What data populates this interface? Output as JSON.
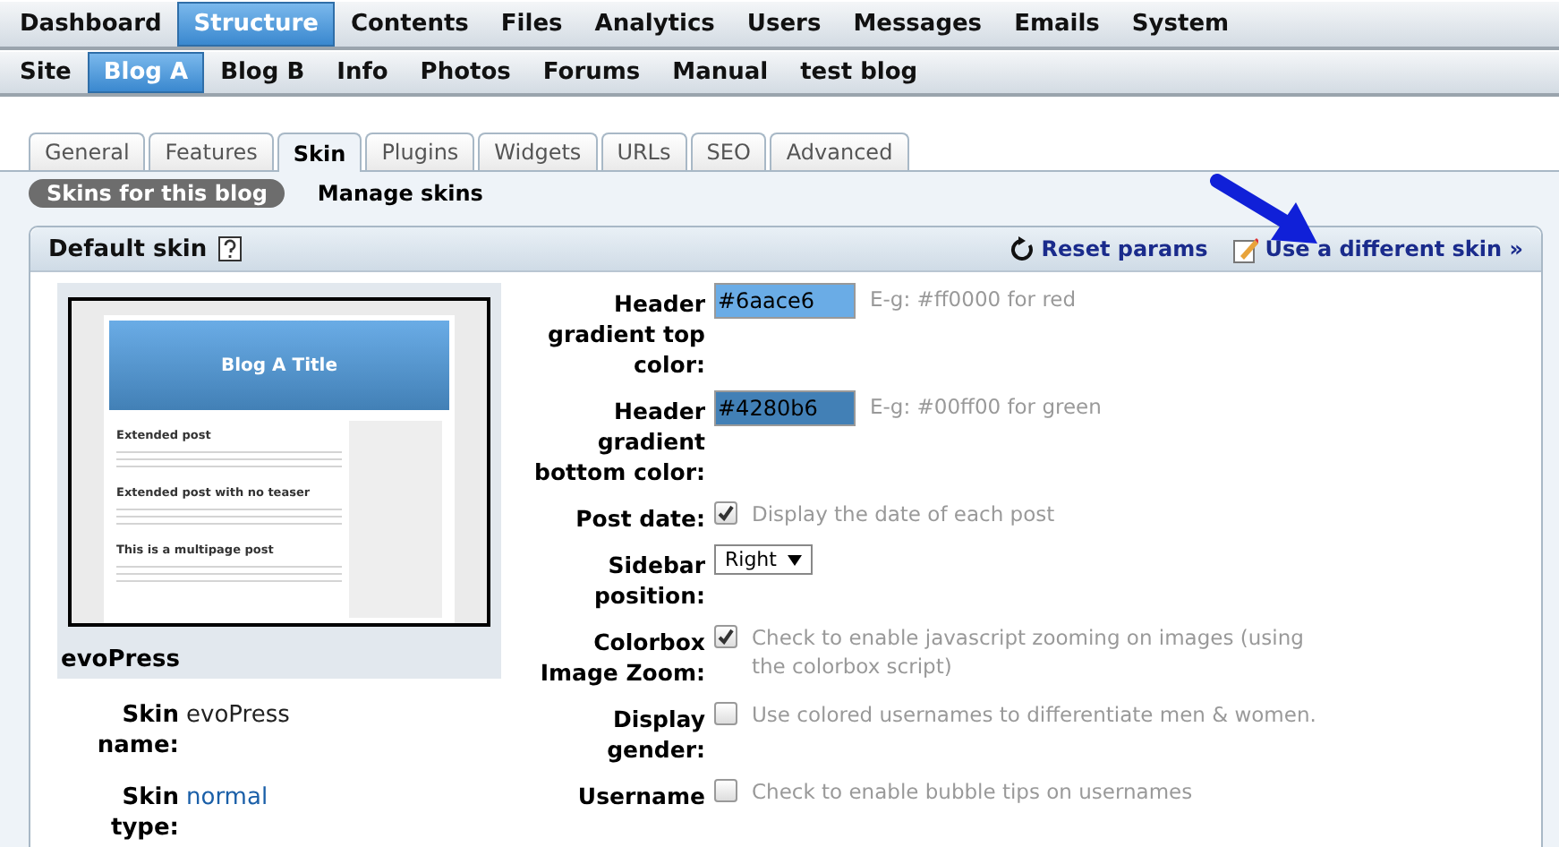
{
  "main_menu": [
    {
      "label": "Dashboard",
      "selected": false
    },
    {
      "label": "Structure",
      "selected": true
    },
    {
      "label": "Contents",
      "selected": false
    },
    {
      "label": "Files",
      "selected": false
    },
    {
      "label": "Analytics",
      "selected": false
    },
    {
      "label": "Users",
      "selected": false
    },
    {
      "label": "Messages",
      "selected": false
    },
    {
      "label": "Emails",
      "selected": false
    },
    {
      "label": "System",
      "selected": false
    }
  ],
  "blog_menu": [
    {
      "label": "Site",
      "selected": false
    },
    {
      "label": "Blog A",
      "selected": true
    },
    {
      "label": "Blog B",
      "selected": false
    },
    {
      "label": "Info",
      "selected": false
    },
    {
      "label": "Photos",
      "selected": false
    },
    {
      "label": "Forums",
      "selected": false
    },
    {
      "label": "Manual",
      "selected": false
    },
    {
      "label": "test blog",
      "selected": false
    }
  ],
  "tabs": [
    {
      "label": "General",
      "selected": false
    },
    {
      "label": "Features",
      "selected": false
    },
    {
      "label": "Skin",
      "selected": true
    },
    {
      "label": "Plugins",
      "selected": false
    },
    {
      "label": "Widgets",
      "selected": false
    },
    {
      "label": "URLs",
      "selected": false
    },
    {
      "label": "SEO",
      "selected": false
    },
    {
      "label": "Advanced",
      "selected": false
    }
  ],
  "subtabs": [
    {
      "label": "Skins for this blog",
      "selected": true
    },
    {
      "label": "Manage skins",
      "selected": false
    }
  ],
  "panel": {
    "title": "Default skin",
    "actions": [
      "Reset params",
      "Use a different skin »"
    ]
  },
  "skin_preview": {
    "blog_title": "Blog A Title",
    "posts": [
      "Extended post",
      "Extended post with no teaser",
      "This is a multipage post"
    ],
    "skin_label": "evoPress"
  },
  "skin_info": [
    {
      "label": "Skin name:",
      "value": "evoPress"
    },
    {
      "label": "Skin type:",
      "value": "normal"
    }
  ],
  "fields": [
    {
      "kind": "color",
      "label": "Header gradient top color:",
      "value": "#6aace6",
      "hint": "E-g: #ff0000 for red",
      "color": "#6aace6"
    },
    {
      "kind": "color",
      "label": "Header gradient bottom color:",
      "value": "#4280b6",
      "hint": "E-g: #00ff00 for green",
      "color": "#4280b6"
    },
    {
      "kind": "checkbox",
      "label": "Post date:",
      "checked": true,
      "hint": "Display the date of each post"
    },
    {
      "kind": "select",
      "label": "Sidebar position:",
      "value": "Right"
    },
    {
      "kind": "checkbox",
      "label": "Colorbox Image Zoom:",
      "checked": true,
      "hint": "Check to enable javascript zooming on images (using the colorbox script)"
    },
    {
      "kind": "checkbox",
      "label": "Display gender:",
      "checked": false,
      "hint": "Use colored usernames to differentiate men & women."
    },
    {
      "kind": "checkbox",
      "label": "Username",
      "checked": false,
      "hint": "Check to enable bubble tips on usernames"
    }
  ]
}
